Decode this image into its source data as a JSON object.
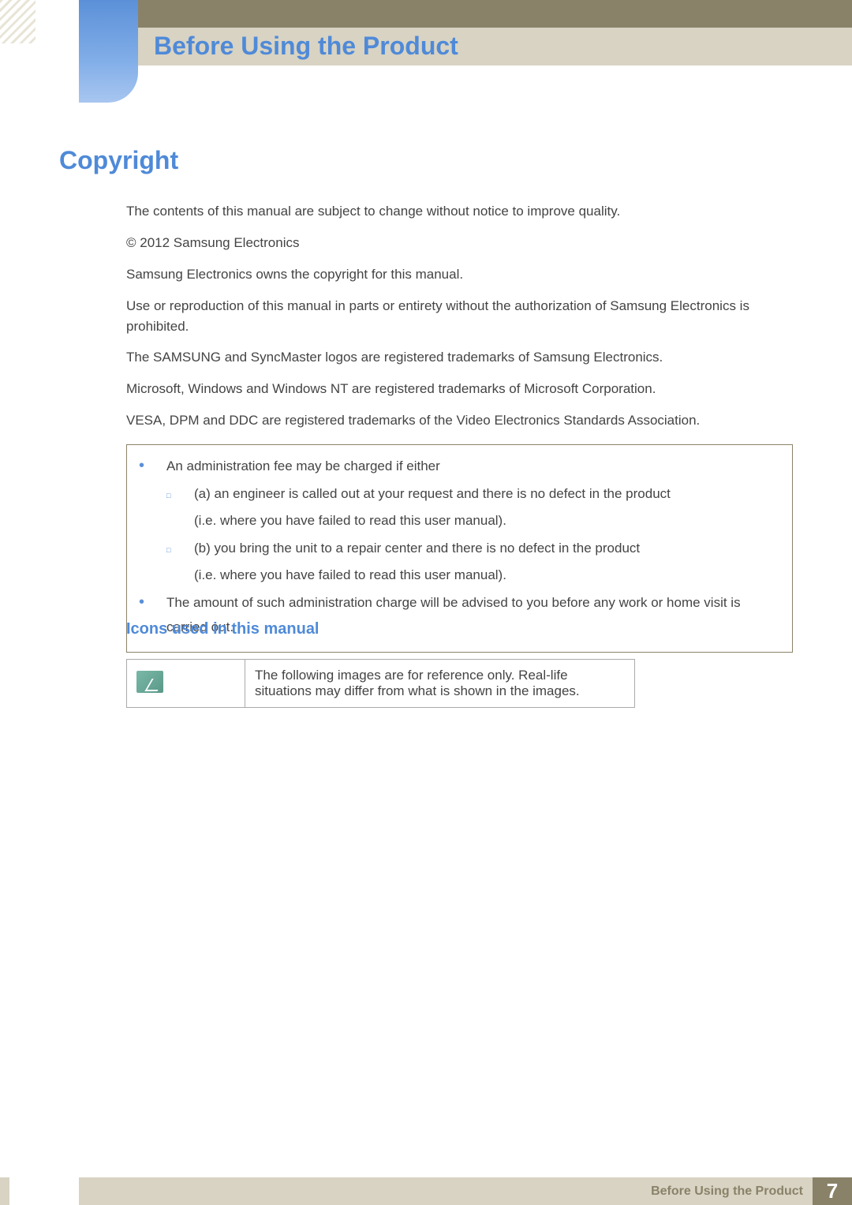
{
  "chapter": {
    "title": "Before Using the Product"
  },
  "section": {
    "title": "Copyright"
  },
  "paragraphs": {
    "p1": "The contents of this manual are subject to change without notice to improve quality.",
    "p2": "© 2012 Samsung Electronics",
    "p3": "Samsung Electronics owns the copyright for this manual.",
    "p4": "Use or reproduction of this manual in parts or entirety without the authorization of Samsung Electronics is prohibited.",
    "p5": "The SAMSUNG and SyncMaster logos are registered trademarks of Samsung Electronics.",
    "p6": "Microsoft, Windows and Windows NT are registered trademarks of Microsoft Corporation.",
    "p7": "VESA, DPM and DDC are registered trademarks of the Video Electronics Standards Association."
  },
  "notice": {
    "b1": "An administration fee may be charged if either",
    "s1a": "(a) an engineer is called out at your request and there is no defect in the product",
    "s1b": "(i.e. where you have failed to read this user manual).",
    "s2a": "(b) you bring the unit to a repair center and there is no defect in the product",
    "s2b": "(i.e. where you have failed to read this user manual).",
    "b2": "The amount of such administration charge will be advised to you before any work or home visit is carried out."
  },
  "subsection": {
    "title": "Icons used in this manual"
  },
  "icon_table": {
    "row1": "The following images are for reference only. Real-life situations may differ from what is shown in the images."
  },
  "footer": {
    "text": "Before Using the Product",
    "page": "7"
  }
}
